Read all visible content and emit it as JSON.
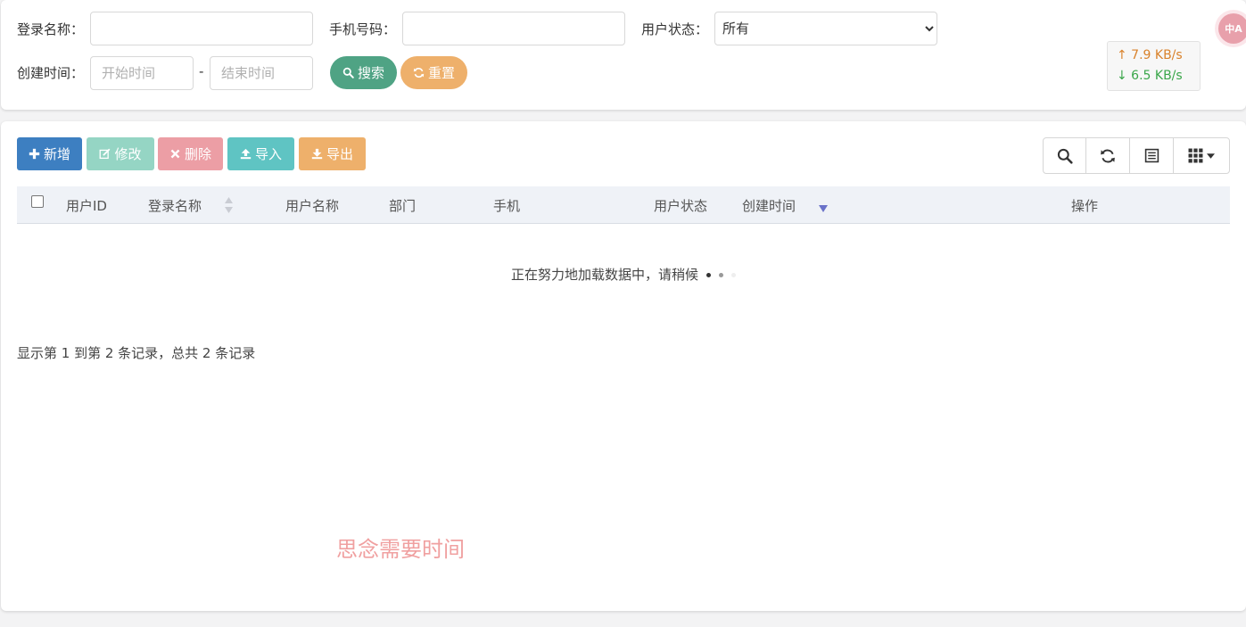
{
  "search": {
    "login_name_label": "登录名称：",
    "login_name_value": "",
    "phone_label": "手机号码：",
    "phone_value": "",
    "status_label": "用户状态：",
    "status_selected": "所有",
    "created_label": "创建时间：",
    "start_placeholder": "开始时间",
    "range_sep": "-",
    "end_placeholder": "结束时间",
    "search_button": "搜索",
    "reset_button": "重置"
  },
  "network": {
    "upload": "↑ 7.9 KB/s",
    "download": "↓ 6.5 KB/s"
  },
  "translate_badge": "中A",
  "toolbar": {
    "add": "新增",
    "edit": "修改",
    "delete": "删除",
    "import": "导入",
    "export": "导出"
  },
  "table": {
    "columns": [
      "用户ID",
      "登录名称",
      "用户名称",
      "部门",
      "手机",
      "用户状态",
      "创建时间",
      "操作"
    ],
    "loading_text": "正在努力地加载数据中，请稍候"
  },
  "pagination": {
    "info": "显示第 1 到第 2 条记录，总共 2 条记录"
  },
  "watermark": "思念需要时间",
  "colors": {
    "primary": "#3d7fc1",
    "success": "#4fa384",
    "warning": "#eeb06b",
    "danger": "#ec9ea5",
    "info": "#5fc4c3",
    "edit": "#95d5c4"
  }
}
